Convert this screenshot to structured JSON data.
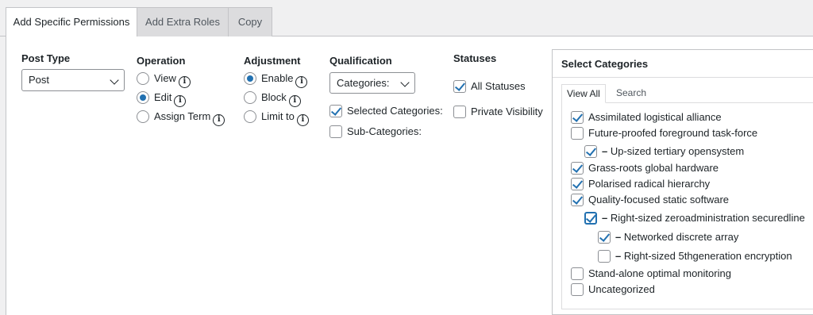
{
  "tabs": [
    "Add Specific Permissions",
    "Add Extra Roles",
    "Copy"
  ],
  "post_type": {
    "heading": "Post Type",
    "selected": "Post"
  },
  "operation": {
    "heading": "Operation",
    "options": [
      "View",
      "Edit",
      "Assign Term"
    ],
    "selected": "Edit"
  },
  "adjustment": {
    "heading": "Adjustment",
    "options": [
      "Enable",
      "Block",
      "Limit to"
    ],
    "selected": "Enable"
  },
  "qualification": {
    "heading": "Qualification",
    "selected": "Categories:",
    "options": [
      {
        "label": "Selected Categories:",
        "checked": true
      },
      {
        "label": "Sub-Categories:",
        "checked": false
      }
    ]
  },
  "statuses": {
    "heading": "Statuses",
    "options": [
      {
        "label": "All Statuses",
        "checked": true
      },
      {
        "label": "Private Visibility",
        "checked": false
      }
    ]
  },
  "categories": {
    "title": "Select Categories",
    "tabs": [
      "View All",
      "Search"
    ],
    "items": [
      {
        "label": "Assimilated logistical alliance",
        "checked": true,
        "depth": 0
      },
      {
        "label": "Future-proofed foreground task-force",
        "checked": false,
        "depth": 0
      },
      {
        "label": "Up-sized tertiary opensystem",
        "checked": true,
        "depth": 1
      },
      {
        "label": "Grass-roots global hardware",
        "checked": true,
        "depth": 0
      },
      {
        "label": "Polarised radical hierarchy",
        "checked": true,
        "depth": 0
      },
      {
        "label": "Quality-focused static software",
        "checked": true,
        "depth": 0
      },
      {
        "label": "Right-sized zeroadministration securedline",
        "checked": true,
        "depth": 1
      },
      {
        "label": "Networked discrete array",
        "checked": true,
        "depth": 2
      },
      {
        "label": "Right-sized 5thgeneration encryption",
        "checked": false,
        "depth": 2
      },
      {
        "label": "Stand-alone optimal monitoring",
        "checked": false,
        "depth": 0
      },
      {
        "label": "Uncategorized",
        "checked": false,
        "depth": 0
      }
    ]
  },
  "colors": {
    "accent": "#2271b1",
    "border": "#c3c4c7",
    "background": "#f0f0f1"
  }
}
